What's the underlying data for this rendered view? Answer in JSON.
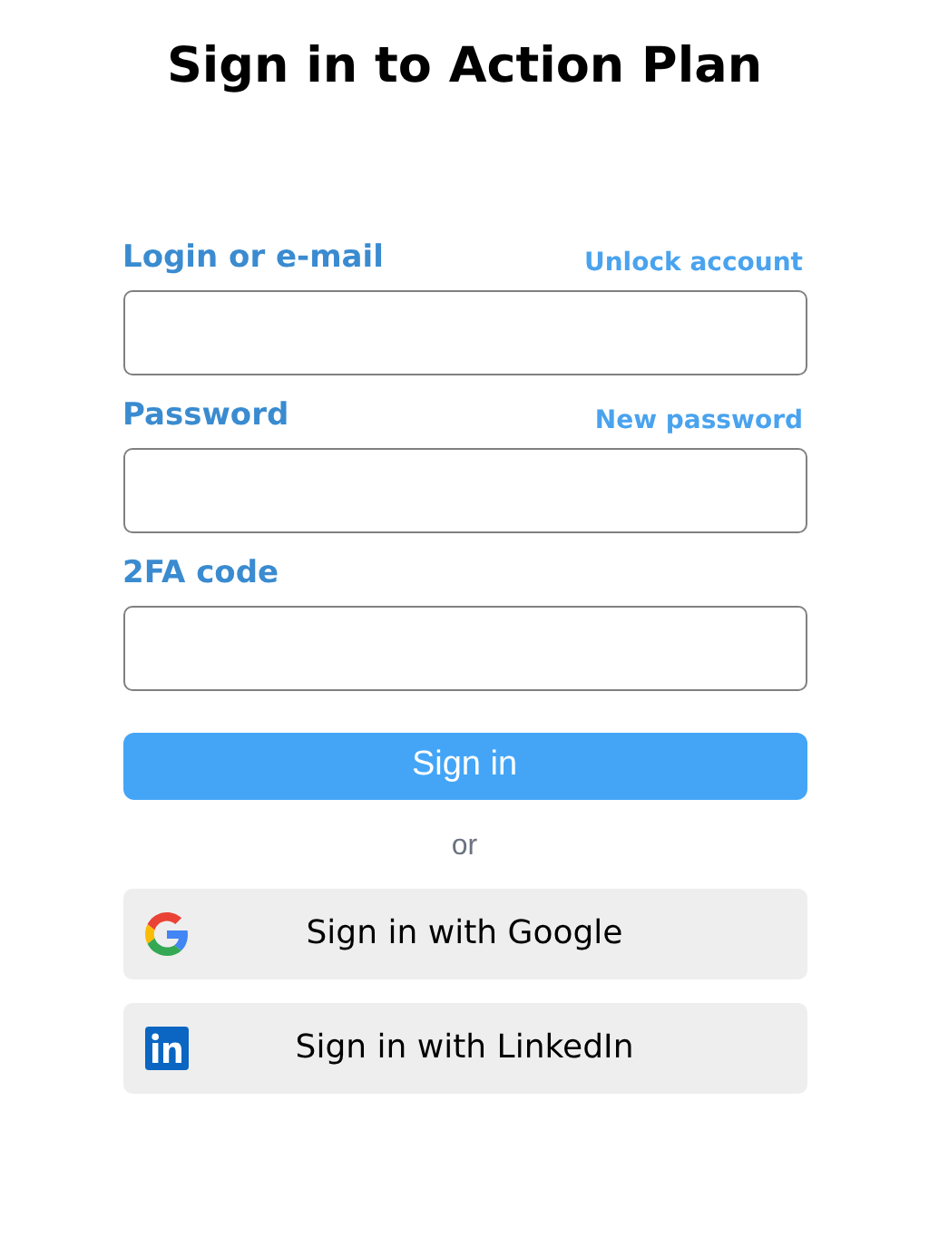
{
  "title": "Sign in to Action Plan",
  "fields": [
    {
      "label": "Login or e-mail",
      "link": "Unlock account"
    },
    {
      "label": "Password",
      "link": "New password"
    },
    {
      "label": "2FA code"
    }
  ],
  "submit": "Sign in",
  "separator": "or",
  "providers": [
    {
      "kind": "google",
      "label": "Sign in with Google"
    },
    {
      "kind": "linkedin",
      "label": "Sign in with LinkedIn"
    }
  ]
}
